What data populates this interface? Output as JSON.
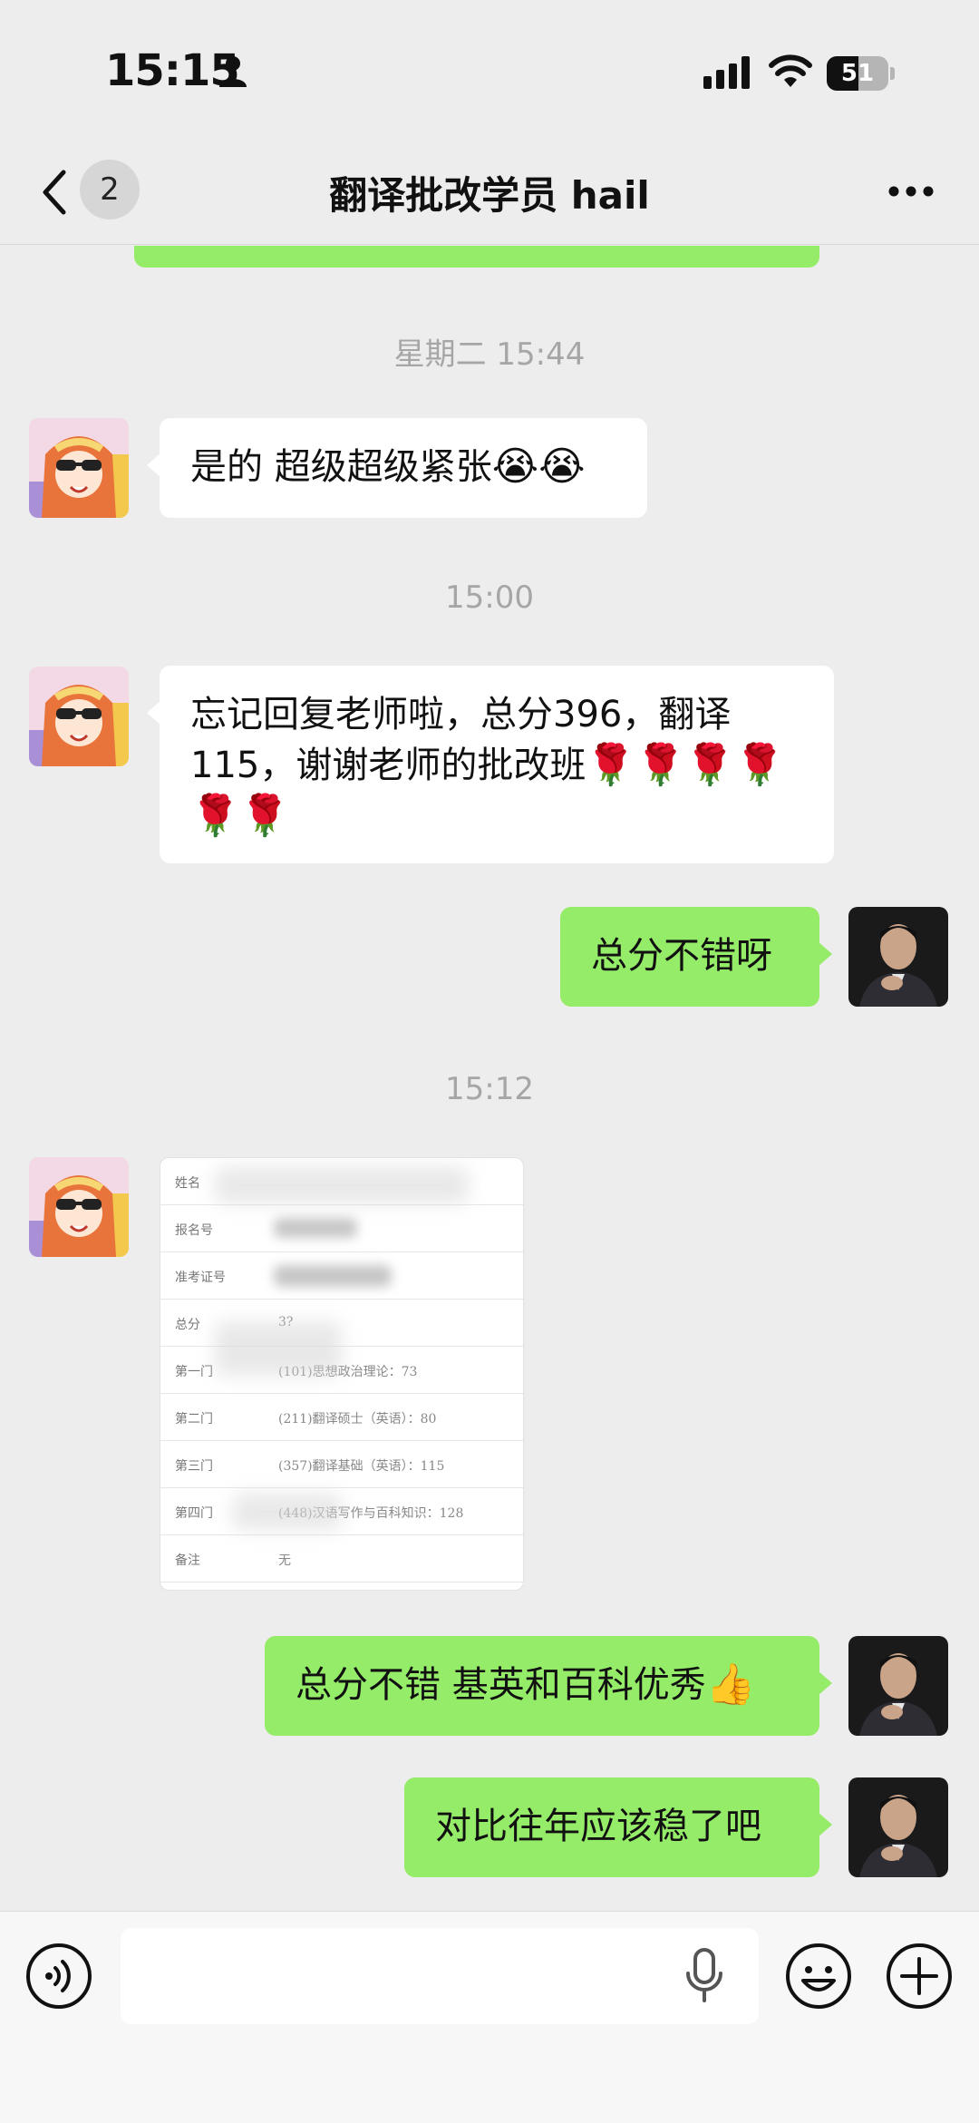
{
  "status_bar": {
    "time": "15:15",
    "battery": "51",
    "battery_level_percent": 51,
    "icons": [
      "person-icon",
      "signal-icon",
      "wifi-icon",
      "battery-icon"
    ]
  },
  "nav": {
    "back_icon": "chevron-left-icon",
    "unread_count": "2",
    "title": "翻译批改学员 hail",
    "more_icon": "more-dots-icon"
  },
  "messages": {
    "ts1": "星期二 15:44",
    "m1": {
      "text": "是的 超级超级紧张",
      "emoji": "😭😭"
    },
    "ts2": "15:00",
    "m2": {
      "line1": "忘记回复老师啦，总分396，翻译",
      "line2": "115，谢谢老师的批改班",
      "roses_line2": "🌹🌹🌹🌹",
      "roses_line3": "🌹🌹"
    },
    "m3": {
      "text": "总分不错呀"
    },
    "ts3": "15:12",
    "score_card": {
      "rows": [
        {
          "k": "姓名",
          "v": ""
        },
        {
          "k": "报名号",
          "v": ""
        },
        {
          "k": "准考证号",
          "v": ""
        },
        {
          "k": "总分",
          "v": "3?"
        },
        {
          "k": "第一门",
          "v": "(101)思想政治理论：73"
        },
        {
          "k": "第二门",
          "v": "(211)翻译硕士（英语）：80"
        },
        {
          "k": "第三门",
          "v": "(357)翻译基础（英语）：115"
        },
        {
          "k": "第四门",
          "v": "(448)汉语写作与百科知识：128"
        },
        {
          "k": "备注",
          "v": "无"
        }
      ]
    },
    "m4": {
      "text": "总分不错 基英和百科优秀",
      "emoji": "👍"
    },
    "m5": {
      "text": "对比往年应该稳了吧"
    }
  },
  "input_bar": {
    "voice_icon": "voice-mode-icon",
    "mic_icon": "microphone-icon",
    "emoji_icon": "emoji-face-icon",
    "plus_icon": "plus-circle-icon",
    "placeholder": ""
  },
  "colors": {
    "background": "#ededed",
    "my_bubble": "#95ec69",
    "their_bubble": "#ffffff",
    "timestamp": "#a6a6a6"
  }
}
